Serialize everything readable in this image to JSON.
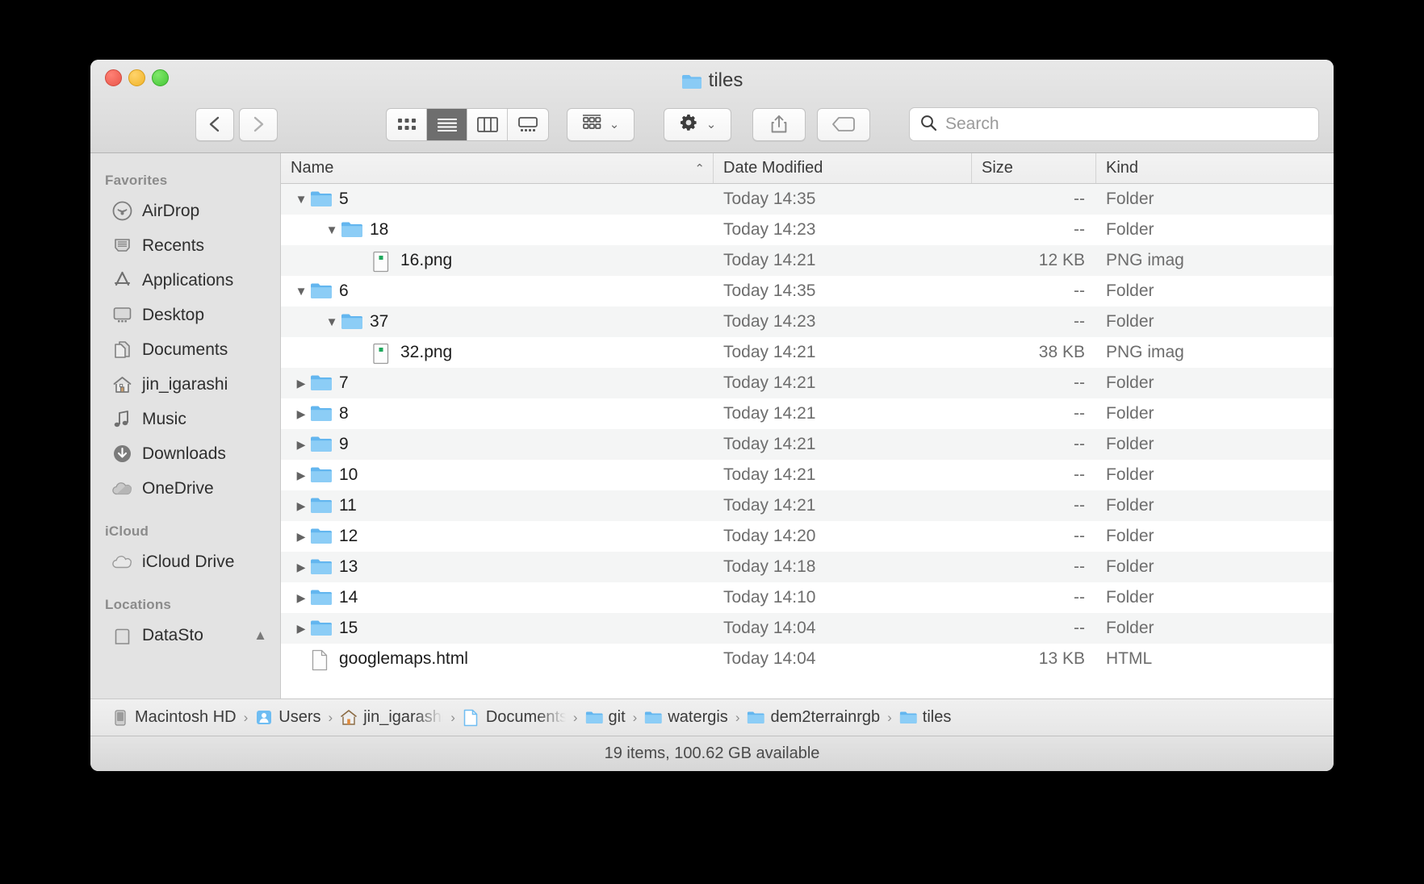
{
  "window": {
    "title": "tiles",
    "title_icon": "folder-icon",
    "traffic_lights": [
      {
        "name": "close-button",
        "color": "#e9564a"
      },
      {
        "name": "minimize-button",
        "color": "#f0b429"
      },
      {
        "name": "zoom-button",
        "color": "#45c637"
      }
    ]
  },
  "toolbar": {
    "back_label": "‹",
    "forward_label": "›",
    "view_modes": [
      {
        "name": "icon-view-button",
        "icon": "grid-icon",
        "active": false
      },
      {
        "name": "list-view-button",
        "icon": "list-icon",
        "active": true
      },
      {
        "name": "column-view-button",
        "icon": "columns-icon",
        "active": false
      },
      {
        "name": "gallery-view-button",
        "icon": "gallery-icon",
        "active": false
      }
    ],
    "group_button": {
      "name": "arrange-button",
      "icon": "grid-dots-icon",
      "chevron": "⌄"
    },
    "action_button": {
      "name": "action-menu-button",
      "icon": "gear-icon",
      "chevron": "⌄"
    },
    "share_button": {
      "name": "share-button",
      "icon": "share-icon"
    },
    "tag_button": {
      "name": "tag-button",
      "icon": "tag-icon"
    }
  },
  "search": {
    "icon": "search-icon",
    "placeholder": "Search",
    "value": ""
  },
  "sidebar": {
    "sections": [
      {
        "header": "Favorites",
        "items": [
          {
            "label": "AirDrop",
            "icon": "airdrop-icon"
          },
          {
            "label": "Recents",
            "icon": "recents-icon"
          },
          {
            "label": "Applications",
            "icon": "applications-icon"
          },
          {
            "label": "Desktop",
            "icon": "desktop-icon"
          },
          {
            "label": "Documents",
            "icon": "documents-icon"
          },
          {
            "label": "jin_igarashi",
            "icon": "home-icon"
          },
          {
            "label": "Music",
            "icon": "music-icon"
          },
          {
            "label": "Downloads",
            "icon": "downloads-icon"
          },
          {
            "label": "OneDrive",
            "icon": "cloud-icon"
          }
        ]
      },
      {
        "header": "iCloud",
        "items": [
          {
            "label": "iCloud Drive",
            "icon": "icloud-icon"
          }
        ]
      },
      {
        "header": "Locations",
        "items": [
          {
            "label": "DataSto",
            "icon": "drive-icon",
            "truncated": true,
            "eject": "▲"
          }
        ]
      }
    ]
  },
  "columns": [
    {
      "key": "name",
      "label": "Name",
      "sorted": true,
      "sort_arrow": "⌃"
    },
    {
      "key": "date",
      "label": "Date Modified"
    },
    {
      "key": "size",
      "label": "Size"
    },
    {
      "key": "kind",
      "label": "Kind"
    }
  ],
  "rows": [
    {
      "name": "5",
      "depth": 0,
      "disclosure": "open",
      "icon": "folder-icon",
      "date": "Today 14:35",
      "size": "--",
      "kind": "Folder"
    },
    {
      "name": "18",
      "depth": 1,
      "disclosure": "open",
      "icon": "folder-icon",
      "date": "Today 14:23",
      "size": "--",
      "kind": "Folder"
    },
    {
      "name": "16.png",
      "depth": 2,
      "disclosure": "none",
      "icon": "png-icon",
      "date": "Today 14:21",
      "size": "12 KB",
      "kind": "PNG imag"
    },
    {
      "name": "6",
      "depth": 0,
      "disclosure": "open",
      "icon": "folder-icon",
      "date": "Today 14:35",
      "size": "--",
      "kind": "Folder"
    },
    {
      "name": "37",
      "depth": 1,
      "disclosure": "open",
      "icon": "folder-icon",
      "date": "Today 14:23",
      "size": "--",
      "kind": "Folder"
    },
    {
      "name": "32.png",
      "depth": 2,
      "disclosure": "none",
      "icon": "png-icon",
      "date": "Today 14:21",
      "size": "38 KB",
      "kind": "PNG imag"
    },
    {
      "name": "7",
      "depth": 0,
      "disclosure": "closed",
      "icon": "folder-icon",
      "date": "Today 14:21",
      "size": "--",
      "kind": "Folder"
    },
    {
      "name": "8",
      "depth": 0,
      "disclosure": "closed",
      "icon": "folder-icon",
      "date": "Today 14:21",
      "size": "--",
      "kind": "Folder"
    },
    {
      "name": "9",
      "depth": 0,
      "disclosure": "closed",
      "icon": "folder-icon",
      "date": "Today 14:21",
      "size": "--",
      "kind": "Folder"
    },
    {
      "name": "10",
      "depth": 0,
      "disclosure": "closed",
      "icon": "folder-icon",
      "date": "Today 14:21",
      "size": "--",
      "kind": "Folder"
    },
    {
      "name": "11",
      "depth": 0,
      "disclosure": "closed",
      "icon": "folder-icon",
      "date": "Today 14:21",
      "size": "--",
      "kind": "Folder"
    },
    {
      "name": "12",
      "depth": 0,
      "disclosure": "closed",
      "icon": "folder-icon",
      "date": "Today 14:20",
      "size": "--",
      "kind": "Folder"
    },
    {
      "name": "13",
      "depth": 0,
      "disclosure": "closed",
      "icon": "folder-icon",
      "date": "Today 14:18",
      "size": "--",
      "kind": "Folder"
    },
    {
      "name": "14",
      "depth": 0,
      "disclosure": "closed",
      "icon": "folder-icon",
      "date": "Today 14:10",
      "size": "--",
      "kind": "Folder"
    },
    {
      "name": "15",
      "depth": 0,
      "disclosure": "closed",
      "icon": "folder-icon",
      "date": "Today 14:04",
      "size": "--",
      "kind": "Folder"
    },
    {
      "name": "googlemaps.html",
      "depth": 0,
      "disclosure": "none",
      "icon": "html-icon",
      "date": "Today 14:04",
      "size": "13 KB",
      "kind": "HTML"
    }
  ],
  "pathbar": {
    "separator": "›",
    "crumbs": [
      {
        "label": "Macintosh HD",
        "icon": "harddisk-icon",
        "truncated": false
      },
      {
        "label": "Users",
        "icon": "users-icon",
        "truncated": false
      },
      {
        "label": "jin_igarashi",
        "icon": "home-icon",
        "truncated": true
      },
      {
        "label": "Documents",
        "icon": "documents-icon",
        "truncated": true
      },
      {
        "label": "git",
        "icon": "folder-icon",
        "truncated": false
      },
      {
        "label": "watergis",
        "icon": "folder-icon",
        "truncated": false
      },
      {
        "label": "dem2terrainrgb",
        "icon": "folder-icon",
        "truncated": false
      },
      {
        "label": "tiles",
        "icon": "folder-icon",
        "truncated": false
      }
    ]
  },
  "statusbar": {
    "text": "19 items, 100.62 GB available"
  },
  "colors": {
    "folder_blue": "#6fbdf2",
    "window_chrome": "#e8e8e8",
    "sidebar_bg": "#e3e3e3",
    "row_alt": "#f4f5f5",
    "active_segment": "#6e6e6e"
  }
}
